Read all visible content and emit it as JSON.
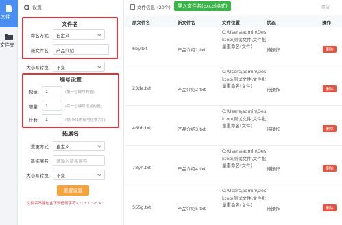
{
  "rail": {
    "items": [
      {
        "label": "文件"
      },
      {
        "label": "文件夹"
      }
    ]
  },
  "settings": {
    "header": "设置",
    "filename_section": {
      "title": "文件名",
      "mode_label": "命名方式:",
      "mode_value": "自定义",
      "new_name_label": "新文件名:",
      "new_name_value": "产品介绍"
    },
    "case_label": "大小写转换:",
    "case_value": "不变",
    "numbering_section": {
      "title": "编号设置",
      "start_label": "起始:",
      "start_value": "1",
      "start_hint": "(第一位编号的值)",
      "step_label": "增量:",
      "step_value": "1",
      "step_hint": "(后一位编号增加的值)",
      "digits_label": "位数:",
      "digits_value": "1",
      "digits_hint": "(例:001的编号位数为3)"
    },
    "ext_section": {
      "title": "拓展名",
      "mode_label": "变更方式:",
      "mode_value": "自定义",
      "new_ext_label": "新拓展名:",
      "new_ext_placeholder": "请输入新拓展名",
      "case_label": "大小写转换:",
      "case_value": "不变"
    },
    "reset_label": "重置设置",
    "warning": "文件名不能包含下列任何字符:\\ / : * ? \" < > |"
  },
  "toolbar": {
    "file_info": "文件信息",
    "count": "(20个)",
    "import_label": "导入文件名(excel格式)",
    "right_text": "清空"
  },
  "table": {
    "headers": [
      "原文件名",
      "新文件名",
      "文件位置",
      "状态",
      "操作"
    ],
    "rows": [
      {
        "orig": "6by.txt",
        "new": "产品介绍1.txt",
        "path": "C:\\Users\\admin\\Desktop\\测试文件\\文件批量重命名(文件)",
        "status": "待操作",
        "action": "删除"
      },
      {
        "orig": "23de.txt",
        "new": "产品介绍2.txt",
        "path": "C:\\Users\\admin\\Desktop\\测试文件\\文件批量重命名(文件)",
        "status": "待操作",
        "action": "删除"
      },
      {
        "orig": "46hb.txt",
        "new": "产品介绍3.txt",
        "path": "C:\\Users\\admin\\Desktop\\测试文件\\文件批量重命名(文件)",
        "status": "待操作",
        "action": "删除"
      },
      {
        "orig": "78yh.txt",
        "new": "产品介绍4.txt",
        "path": "C:\\Users\\admin\\Desktop\\测试文件\\文件批量重命名(文件)",
        "status": "待操作",
        "action": "删除"
      },
      {
        "orig": "555g.txt",
        "new": "产品介绍5.txt",
        "path": "C:\\Users\\admin\\Desktop\\测试文件\\文件批量重命名(文件)",
        "status": "待操作",
        "action": "删除"
      }
    ]
  },
  "colors": {
    "accent": "#4b8ef2",
    "highlight_border": "#d9363e",
    "import_green": "#3bb54a",
    "reset_orange": "#f7a23b",
    "delete_red": "#e8533f"
  }
}
